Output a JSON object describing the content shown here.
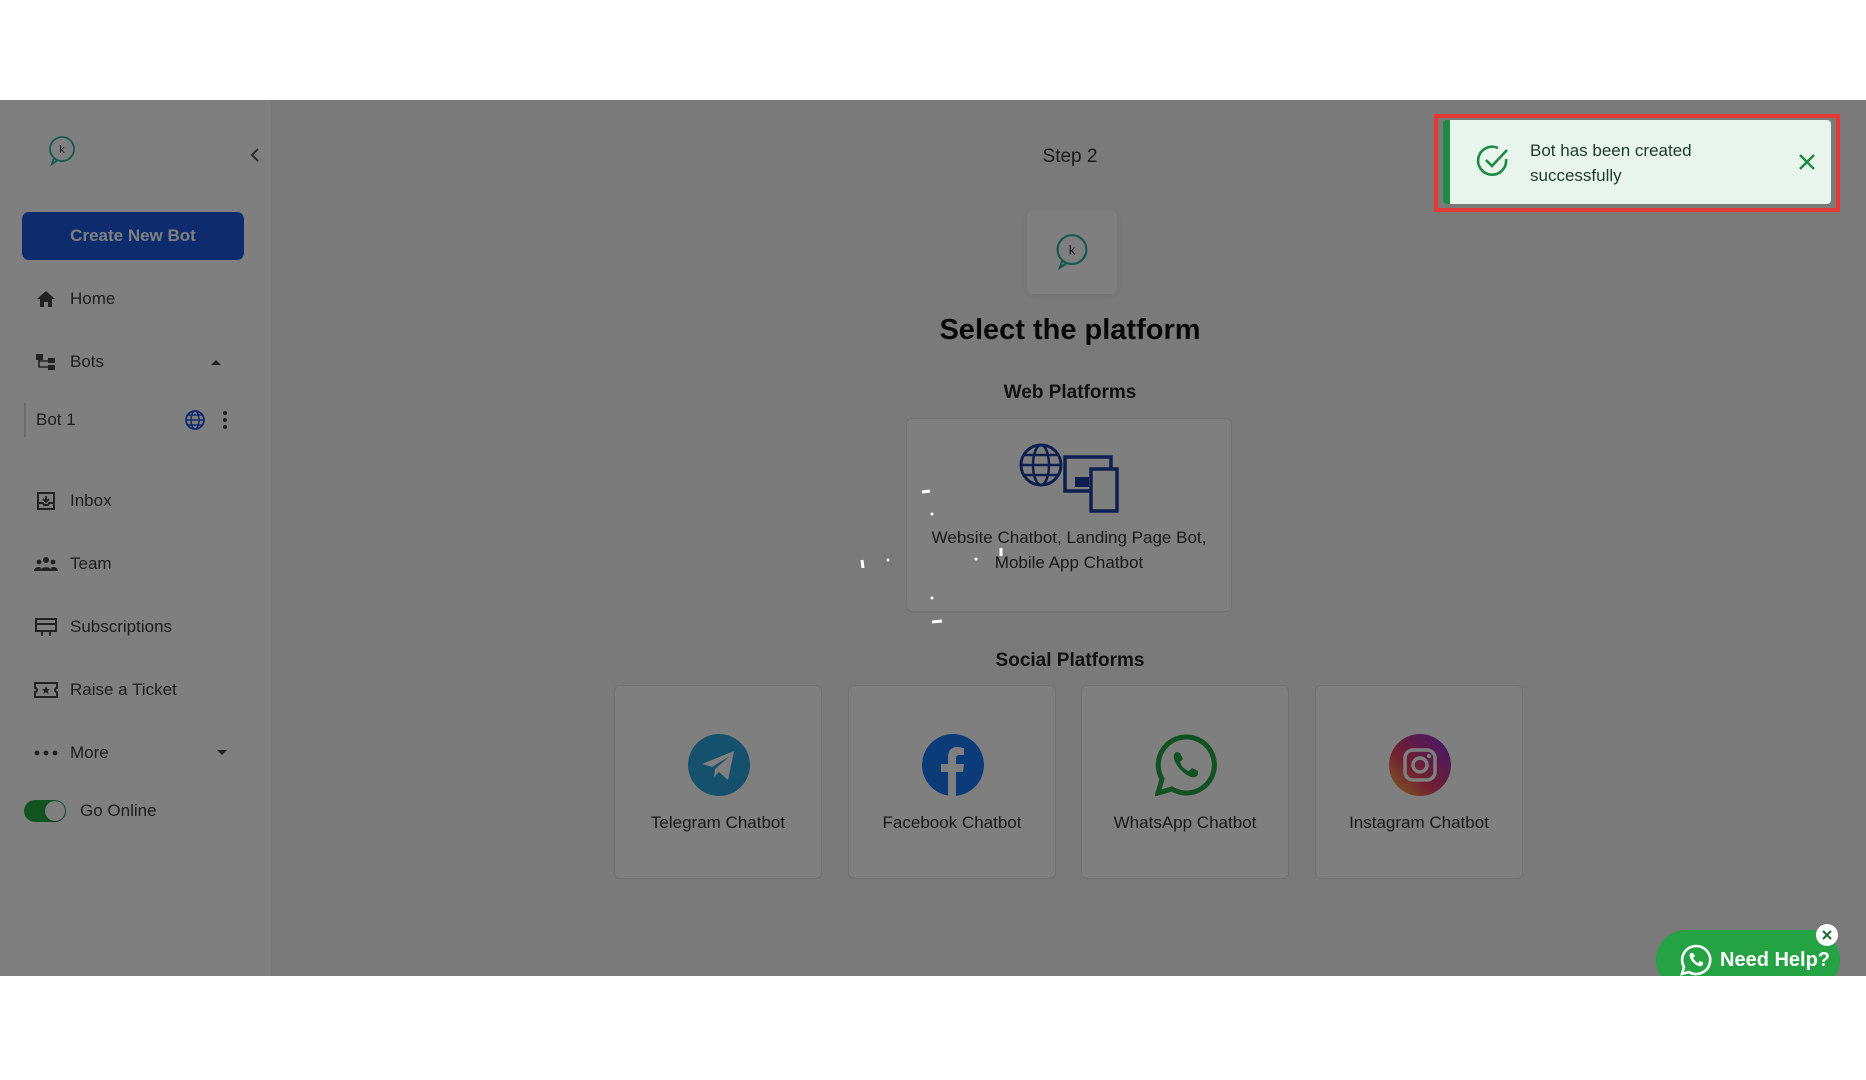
{
  "sidebar": {
    "create_button": "Create New Bot",
    "nav": {
      "home": "Home",
      "bots": "Bots",
      "inbox": "Inbox",
      "team": "Team",
      "subscriptions": "Subscriptions",
      "raise_ticket": "Raise a Ticket",
      "more": "More"
    },
    "bot_item": "Bot 1",
    "toggle_label": "Go Online",
    "toggle_on": true
  },
  "main": {
    "step": "Step 2",
    "title": "Select the platform",
    "web_section": "Web Platforms",
    "web_card_line1": "Website Chatbot, Landing Page Bot,",
    "web_card_line2": "Mobile App Chatbot",
    "social_section": "Social Platforms",
    "social_cards": [
      {
        "label": "Telegram Chatbot",
        "icon": "telegram-icon"
      },
      {
        "label": "Facebook Chatbot",
        "icon": "facebook-icon"
      },
      {
        "label": "WhatsApp Chatbot",
        "icon": "whatsapp-icon"
      },
      {
        "label": "Instagram Chatbot",
        "icon": "instagram-icon"
      }
    ]
  },
  "toast": {
    "line1": "Bot has been created",
    "line2": "successfully"
  },
  "help": {
    "label": "Need Help?"
  },
  "logo_letter": "k",
  "colors": {
    "primary": "#1a56db",
    "success": "#1e8a45",
    "whatsapp": "#25a244",
    "highlight": "#e53935"
  }
}
